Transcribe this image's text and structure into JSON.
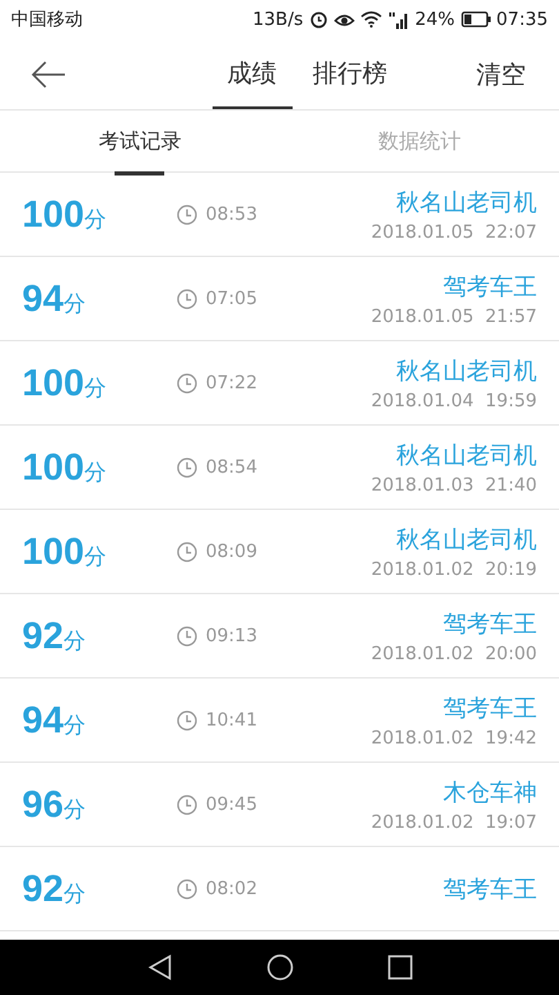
{
  "status_bar": {
    "carrier": "中国移动",
    "speed": "13B/s",
    "battery": "24%",
    "time": "07:35"
  },
  "header": {
    "tabs": [
      {
        "label": "成绩",
        "selected": true
      },
      {
        "label": "排行榜",
        "selected": false
      }
    ],
    "action": "清空"
  },
  "sub_tabs": [
    {
      "label": "考试记录",
      "selected": true
    },
    {
      "label": "数据统计",
      "selected": false
    }
  ],
  "records": [
    {
      "score": "100",
      "unit": "分",
      "duration": "08:53",
      "name": "秋名山老司机",
      "date": "2018.01.05  22:07"
    },
    {
      "score": "94",
      "unit": "分",
      "duration": "07:05",
      "name": "驾考车王",
      "date": "2018.01.05  21:57"
    },
    {
      "score": "100",
      "unit": "分",
      "duration": "07:22",
      "name": "秋名山老司机",
      "date": "2018.01.04  19:59"
    },
    {
      "score": "100",
      "unit": "分",
      "duration": "08:54",
      "name": "秋名山老司机",
      "date": "2018.01.03  21:40"
    },
    {
      "score": "100",
      "unit": "分",
      "duration": "08:09",
      "name": "秋名山老司机",
      "date": "2018.01.02  20:19"
    },
    {
      "score": "92",
      "unit": "分",
      "duration": "09:13",
      "name": "驾考车王",
      "date": "2018.01.02  20:00"
    },
    {
      "score": "94",
      "unit": "分",
      "duration": "10:41",
      "name": "驾考车王",
      "date": "2018.01.02  19:42"
    },
    {
      "score": "96",
      "unit": "分",
      "duration": "09:45",
      "name": "木仓车神",
      "date": "2018.01.02  19:07"
    },
    {
      "score": "92",
      "unit": "分",
      "duration": "08:02",
      "name": "驾考车王"
    }
  ]
}
